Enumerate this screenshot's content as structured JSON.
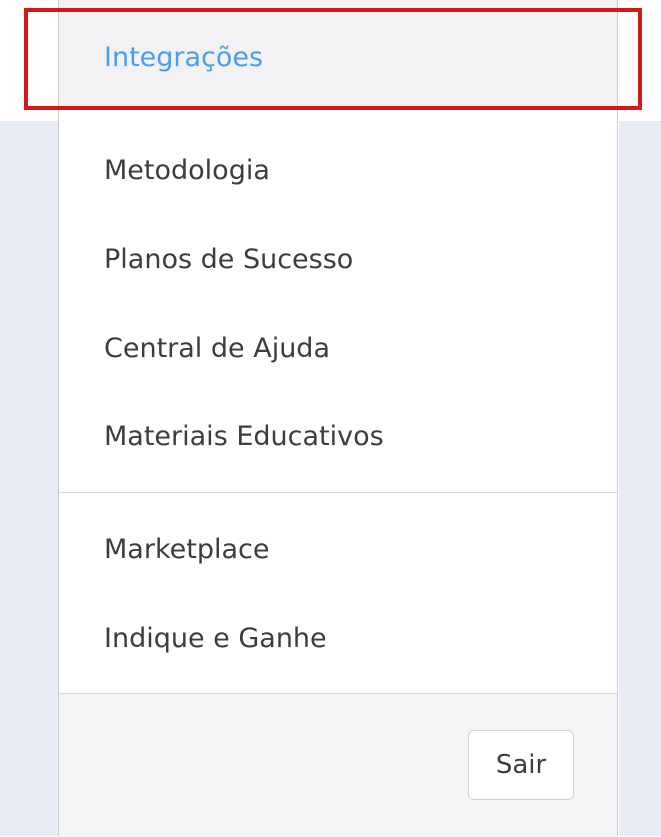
{
  "menu": {
    "highlighted_item": "Integrações",
    "group1": [
      "Metodologia",
      "Planos de Sucesso",
      "Central de Ajuda",
      "Materiais Educativos"
    ],
    "group2": [
      "Marketplace",
      "Indique e Ganhe"
    ]
  },
  "footer": {
    "logout_label": "Sair"
  },
  "colors": {
    "active_link": "#4a9ef0",
    "highlight_border": "#d01919",
    "page_background": "#e8ecf5"
  }
}
